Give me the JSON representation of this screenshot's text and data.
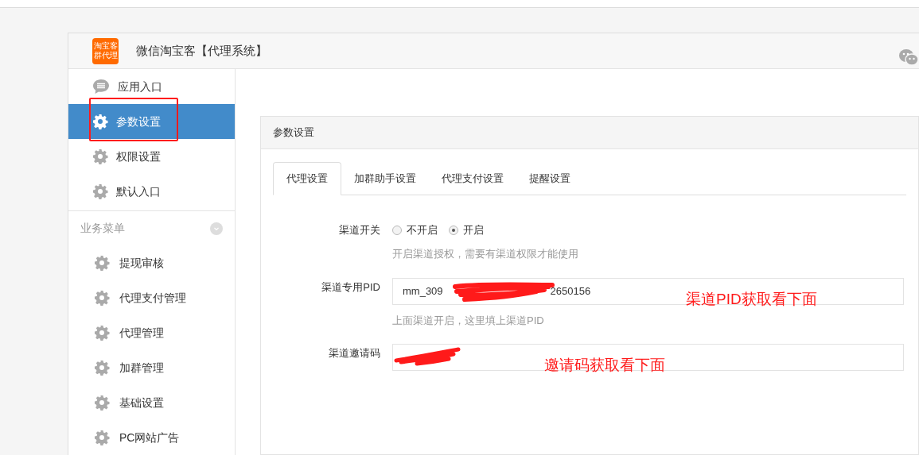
{
  "header": {
    "logo_text": "淘宝客群代理",
    "title": "微信淘宝客【代理系统】"
  },
  "sidebar": {
    "items": [
      {
        "label": "应用入口",
        "kind": "chat",
        "selected": false
      },
      {
        "label": "参数设置",
        "kind": "gear",
        "selected": true
      },
      {
        "label": "权限设置",
        "kind": "gear",
        "selected": false
      },
      {
        "label": "默认入口",
        "kind": "gear",
        "selected": false
      }
    ],
    "section": {
      "title": "业务菜单",
      "expanded": true,
      "items": [
        {
          "label": "提现审核",
          "selected": false
        },
        {
          "label": "代理支付管理",
          "selected": false
        },
        {
          "label": "代理管理",
          "selected": false
        },
        {
          "label": "加群管理",
          "selected": false
        },
        {
          "label": "基础设置",
          "selected": false
        },
        {
          "label": "PC网站广告",
          "selected": false
        }
      ]
    }
  },
  "panel": {
    "title": "参数设置",
    "tabs": [
      {
        "label": "代理设置",
        "selected": true
      },
      {
        "label": "加群助手设置",
        "selected": false
      },
      {
        "label": "代理支付设置",
        "selected": false
      },
      {
        "label": "提醒设置",
        "selected": false
      }
    ],
    "fields": [
      {
        "kind": "radio",
        "label": "渠道开关",
        "options": [
          {
            "label": "不开启",
            "selected": false
          },
          {
            "label": "开启",
            "selected": true
          }
        ],
        "help": "开启渠道授权，需要有渠道权限才能使用"
      },
      {
        "kind": "text",
        "label": "渠道专用PID",
        "value_start": "mm_309",
        "value_end": "2650156",
        "help": "上面渠道开启，这里填上渠道PID",
        "annotation": "渠道PID获取看下面"
      },
      {
        "kind": "text",
        "label": "渠道邀请码",
        "annotation": "邀请码获取看下面"
      }
    ]
  }
}
